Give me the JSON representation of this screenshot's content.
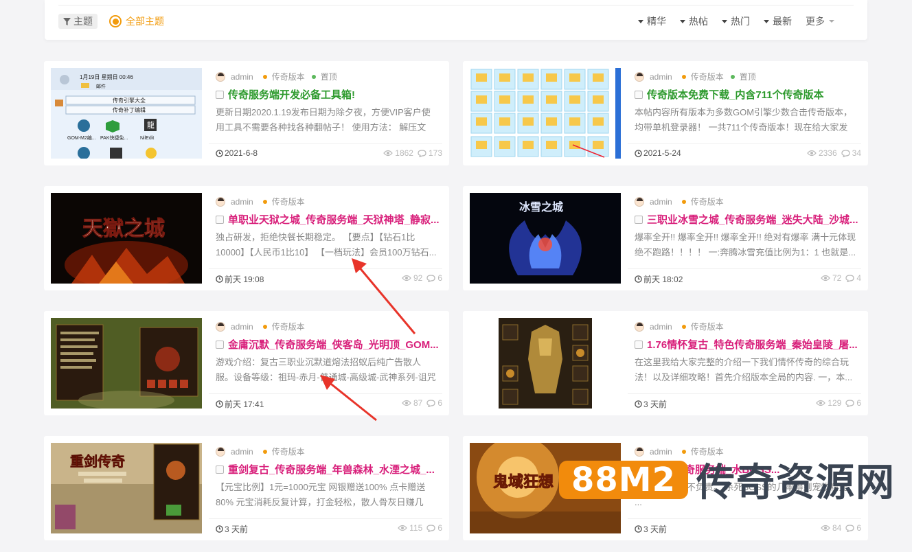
{
  "filter": {
    "topic_label": "主题",
    "all_topics": "全部主题",
    "sorts": [
      "精华",
      "热帖",
      "热门",
      "最新"
    ],
    "more": "更多"
  },
  "posts": [
    {
      "author": "admin",
      "category": "传奇版本",
      "sticky": "置顶",
      "title": "传奇服务端开发必备工具箱!",
      "excerpt": "更新日期2020.1.19发布日期为除夕夜，方便VIP客户使用工具不需要各种找各种翻帖子！ 使用方法： 解压文件...",
      "date": "2021-6-8",
      "views": "1862",
      "comments": "173",
      "thumb": {
        "time": "1月19日 星期日 00:46",
        "mail": "邮件",
        "btn1": "传奇引擎大全",
        "btn2": "传奇补丁编辑",
        "app1": "GOM-M2编...",
        "app2": "PAK快捷免...",
        "app3": "NilEdit",
        "dragon": "龍"
      }
    },
    {
      "author": "admin",
      "category": "传奇版本",
      "sticky": "置顶",
      "title": "传奇版本免费下载_内含711个传奇版本",
      "excerpt": "本帖内容所有版本为多数GOM引擎少数合击传奇版本，均带单机登录器！ 一共711个传奇版本！现在给大家发送...",
      "date": "2021-5-24",
      "views": "2336",
      "comments": "34"
    },
    {
      "author": "admin",
      "category": "传奇版本",
      "title": "单职业天狱之城_传奇服务端_天狱神塔_静寂...",
      "excerpt": "独占研发，拒绝快餐长期稳定。 【要点】【钻石1比10000】【人民币1比10】 【一档玩法】会员100万钻石...",
      "date": "前天 19:08",
      "views": "92",
      "comments": "6",
      "thumb": {
        "logo": "天獄之城"
      }
    },
    {
      "author": "admin",
      "category": "传奇版本",
      "title": "三职业冰雪之城_传奇服务端_迷失大陆_沙城...",
      "excerpt": "爆率全开!! 爆率全开!! 爆率全开!! 绝对有爆率 满十元体现绝不跑路！！！！ 一:奔腾冰雪充值比例为1：1 也就是...",
      "date": "前天 18:02",
      "views": "72",
      "comments": "4",
      "thumb": {
        "logo": "冰雪之城"
      }
    },
    {
      "author": "admin",
      "category": "传奇版本",
      "title": "金庸沉默_传奇服务端_侠客岛_光明顶_GOM...",
      "excerpt": "游戏介绍：复古三职业沉默道熔法招蚁后纯广告散人服。设备等级：祖玛-赤月-普通城-高级城-武神系列-诅咒系...",
      "date": "前天 17:41",
      "views": "87",
      "comments": "6"
    },
    {
      "author": "admin",
      "category": "传奇版本",
      "title": "1.76情怀复古_特色传奇服务端_秦始皇陵_屠...",
      "excerpt": "在这里我给大家完整的介绍一下我们情怀传奇的综合玩法！以及详细攻略！首先介绍版本全局的内容. 一，本...",
      "date": "3 天前",
      "views": "129",
      "comments": "6"
    },
    {
      "author": "admin",
      "category": "传奇版本",
      "title": "重剑复古_传奇服务端_年兽森林_水湮之城_...",
      "excerpt": "【元宝比例】1元=1000元宝 网银赠送100% 点卡赠送80% 元宝消耗反复计算，打金轻松，散人骨灰日赚几百...",
      "date": "3 天前",
      "views": "115",
      "comments": "6",
      "thumb": {
        "logo": "重剑传奇"
      }
    },
    {
      "author": "admin",
      "category": "传奇版本",
      "title": "...光...传奇服务端_水BOSS...",
      "excerpt": "...装备丢失率不负责。 杀死BOSS的几率得到宠物精元, ...",
      "date": "3 天前",
      "views": "84",
      "comments": "6",
      "thumb": {
        "logo": "鬼域狂想"
      }
    }
  ],
  "watermark": {
    "badge": "88M2",
    "text": "传奇资源网"
  },
  "colors": {
    "accent": "#f29b0c",
    "title_green": "#2d9a2d",
    "title_pink": "#d81e7a",
    "watermark_orange": "#f28b0c"
  }
}
